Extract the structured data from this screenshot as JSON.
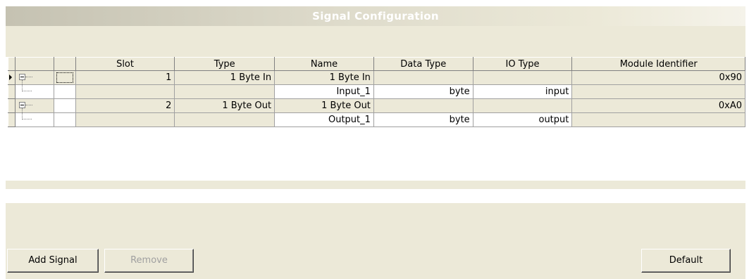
{
  "title": "Signal Configuration",
  "table": {
    "columns": [
      "Slot",
      "Type",
      "Name",
      "Data Type",
      "IO Type",
      "Module Identifier"
    ],
    "rows": [
      {
        "slot": "1",
        "type": "1  Byte In",
        "name": "1  Byte In",
        "data_type": "",
        "io_type": "",
        "module_id": "0x90",
        "level": "module",
        "selected": true
      },
      {
        "slot": "",
        "type": "",
        "name": "Input_1",
        "data_type": "byte",
        "io_type": "input",
        "module_id": "",
        "level": "signal"
      },
      {
        "slot": "2",
        "type": "1  Byte Out",
        "name": "1  Byte Out",
        "data_type": "",
        "io_type": "",
        "module_id": "0xA0",
        "level": "module"
      },
      {
        "slot": "",
        "type": "",
        "name": "Output_1",
        "data_type": "byte",
        "io_type": "output",
        "module_id": "",
        "level": "signal"
      }
    ]
  },
  "buttons": {
    "add_signal": "Add Signal",
    "remove": "Remove",
    "default": "Default"
  },
  "icons": {
    "row_indicator": "right-arrow-icon",
    "expander": "tree-collapse-icon"
  }
}
